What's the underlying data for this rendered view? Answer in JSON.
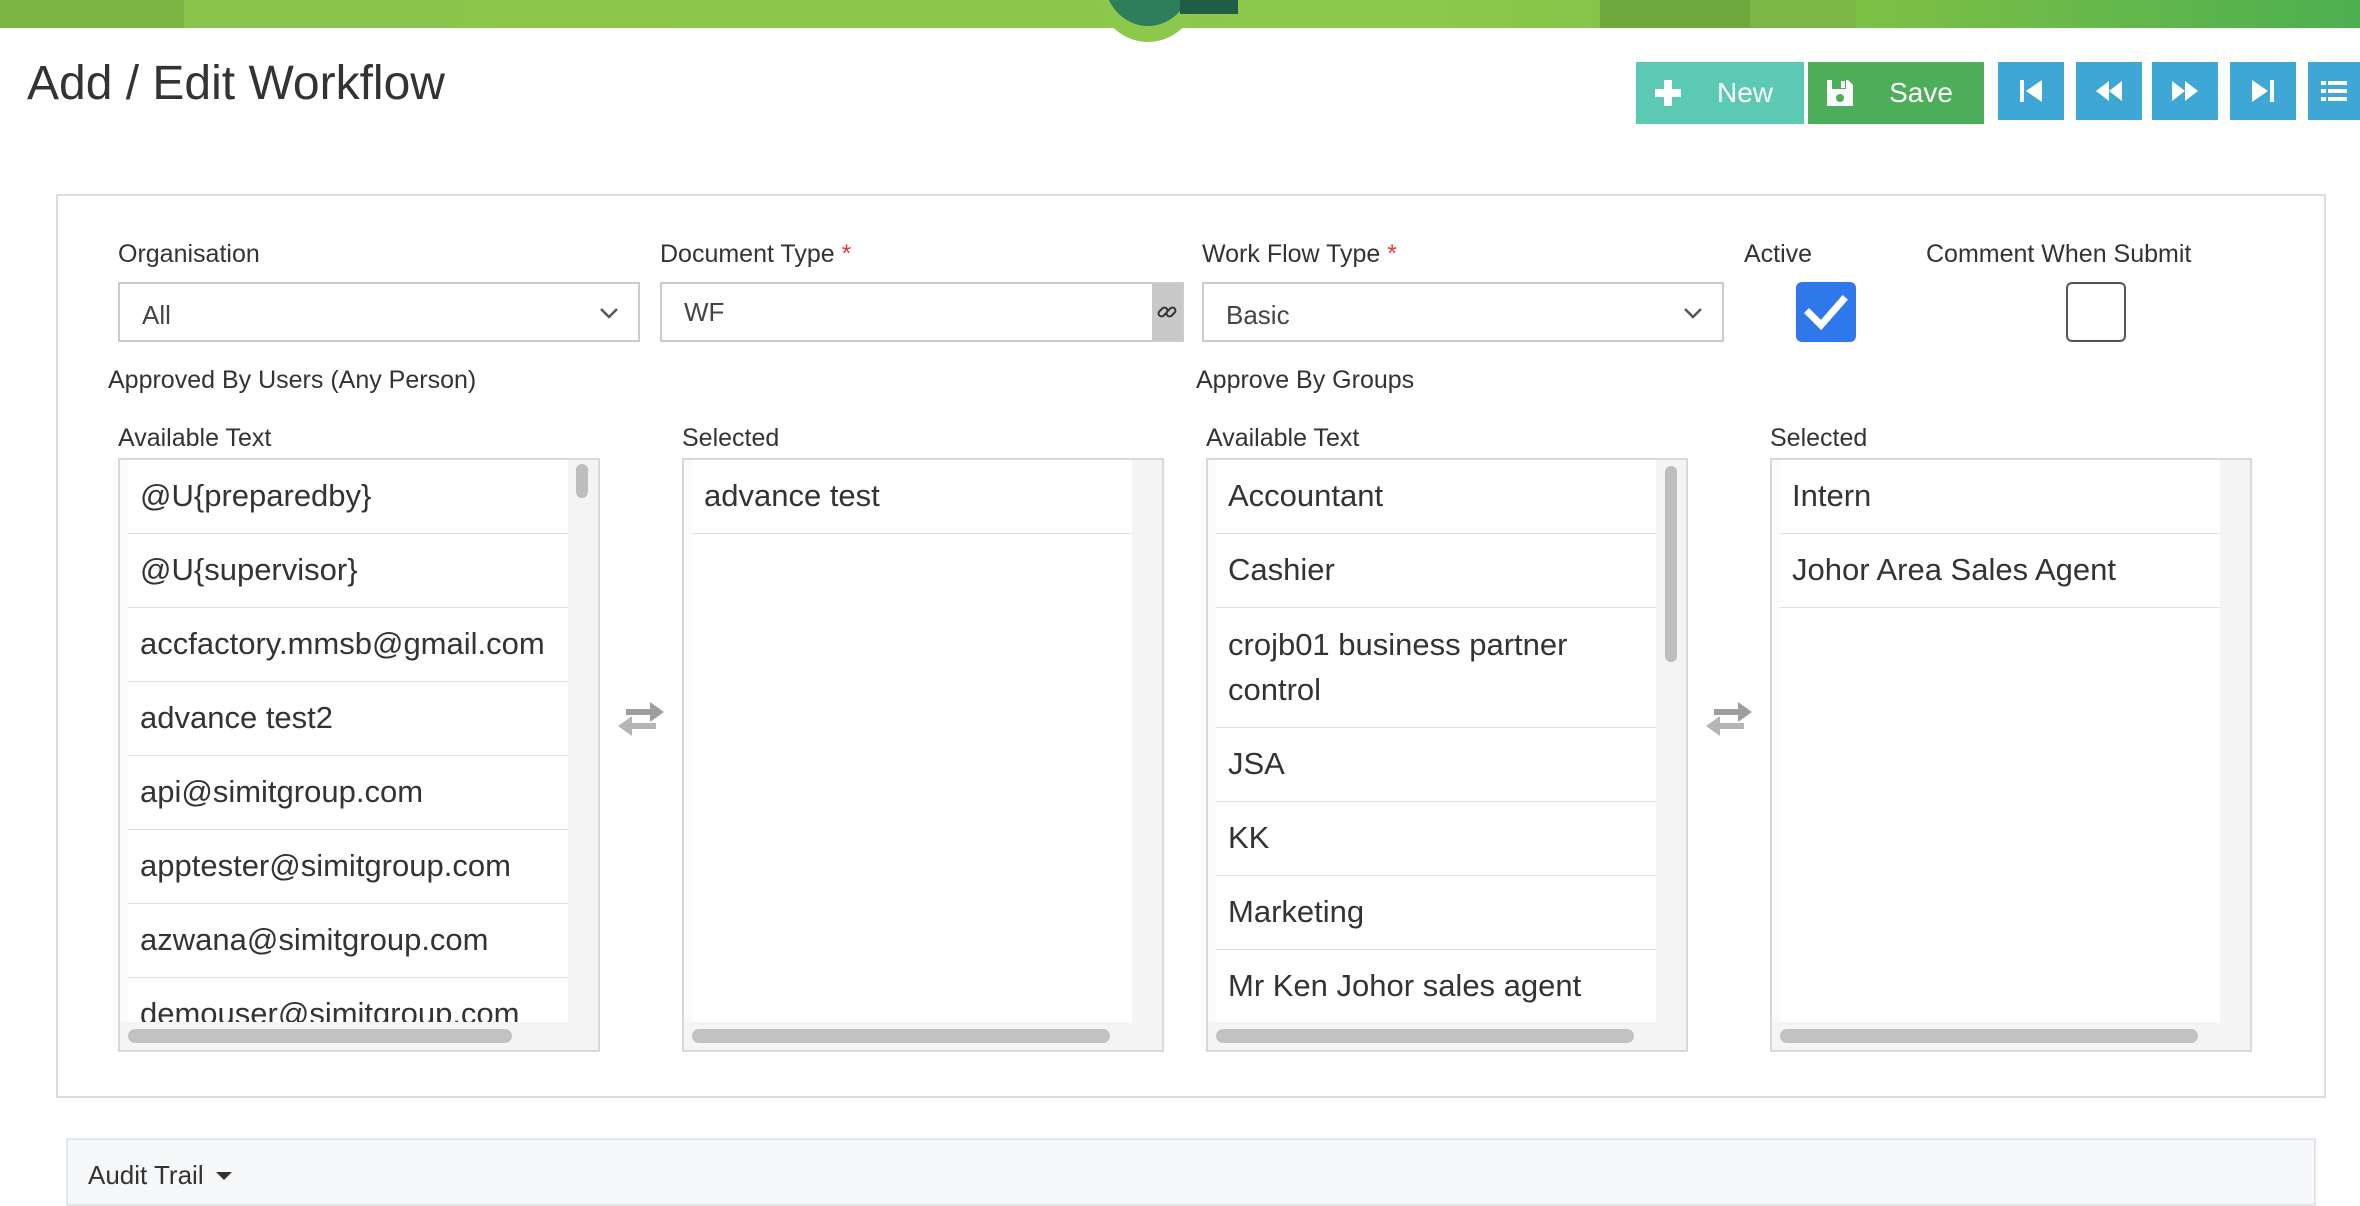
{
  "page": {
    "title": "Add / Edit Workflow"
  },
  "toolbar": {
    "new_label": "New",
    "save_label": "Save",
    "colors": {
      "new": "#5cc9b3",
      "save": "#4cae59",
      "nav": "#3fa7d6"
    },
    "nav_icons": [
      "first-record-icon",
      "previous-record-icon",
      "next-record-icon",
      "last-record-icon",
      "list-icon"
    ]
  },
  "form": {
    "organisation": {
      "label": "Organisation",
      "value": "All"
    },
    "document_type": {
      "label": "Document Type",
      "required": "*",
      "value": "WF"
    },
    "workflow_type": {
      "label": "Work Flow Type",
      "required": "*",
      "value": "Basic"
    },
    "active": {
      "label": "Active",
      "checked": true
    },
    "comment_when_submit": {
      "label": "Comment When Submit",
      "checked": false
    }
  },
  "approved_by_users": {
    "title": "Approved By Users (Any Person)",
    "available_label": "Available Text",
    "selected_label": "Selected",
    "available": [
      "@U{preparedby}",
      "@U{supervisor}",
      "accfactory.mmsb@gmail.com",
      "advance test2",
      "api@simitgroup.com",
      "apptester@simitgroup.com",
      "azwana@simitgroup.com",
      "demouser@simitgroup.com"
    ],
    "selected": [
      "advance test"
    ]
  },
  "approve_by_groups": {
    "title": "Approve By Groups",
    "available_label": "Available Text",
    "selected_label": "Selected",
    "available": [
      "Accountant",
      "Cashier",
      "crojb01 business partner control",
      "JSA",
      "KK",
      "Marketing",
      "Mr Ken Johor sales agent"
    ],
    "selected": [
      "Intern",
      "Johor Area Sales Agent"
    ]
  },
  "audit_trail": {
    "label": "Audit Trail"
  }
}
